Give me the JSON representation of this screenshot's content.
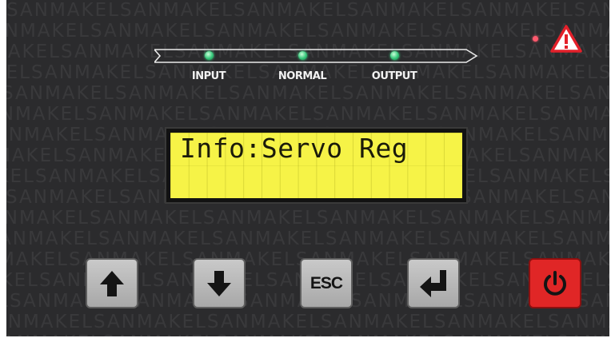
{
  "watermark": {
    "text": "SANMAKEL"
  },
  "indicators": [
    {
      "label": "INPUT",
      "state": "on",
      "color": "#35c77a"
    },
    {
      "label": "NORMAL",
      "state": "on",
      "color": "#35c77a"
    },
    {
      "label": "OUTPUT",
      "state": "on",
      "color": "#35c77a"
    }
  ],
  "alarm": {
    "led_color": "#ff5a6e",
    "icon": "warning-icon",
    "icon_color": "#e3202a"
  },
  "lcd": {
    "line1": "Info:Servo Reg",
    "line2": "",
    "background": "#f6f347"
  },
  "buttons": {
    "up": {
      "icon": "arrow-up-icon"
    },
    "down": {
      "icon": "arrow-down-icon"
    },
    "esc": {
      "label": "ESC"
    },
    "enter": {
      "icon": "enter-icon"
    },
    "power": {
      "icon": "power-icon",
      "color": "#e02626"
    }
  }
}
